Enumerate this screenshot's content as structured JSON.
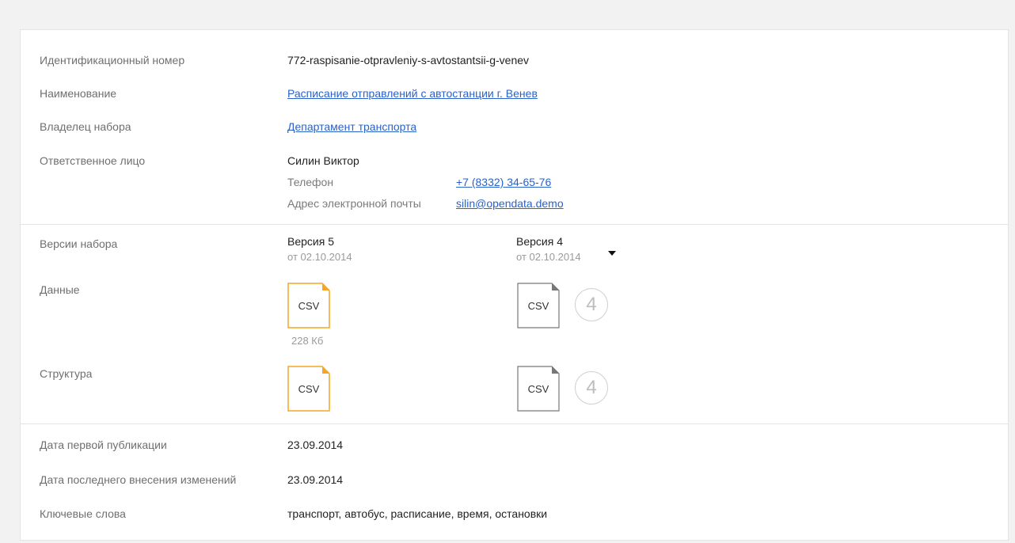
{
  "fields": {
    "id": {
      "label": "Идентификационный номер",
      "value": "772-raspisanie-otpravleniy-s-avtostantsii-g-venev"
    },
    "name": {
      "label": "Наименование",
      "value": "Расписание отправлений с автостанции г. Венев"
    },
    "owner": {
      "label": "Владелец набора",
      "value": "Департамент транспорта"
    },
    "responsible": {
      "label": "Ответственное лицо",
      "person": "Силин Виктор",
      "phone_label": "Телефон",
      "phone": "+7 (8332) 34-65-76",
      "email_label": "Адрес электронной почты",
      "email": "silin@opendata.demo"
    }
  },
  "versions": {
    "label": "Версии набора",
    "current": {
      "title": "Версия 5",
      "date": "от 02.10.2014"
    },
    "previous": {
      "title": "Версия 4",
      "date": "от 02.10.2014"
    },
    "data_label": "Данные",
    "structure_label": "Структура",
    "current_data_file": {
      "format": "CSV",
      "size": "228 Кб"
    },
    "previous_data_file": {
      "format": "CSV",
      "count": "4"
    },
    "current_structure_file": {
      "format": "CSV"
    },
    "previous_structure_file": {
      "format": "CSV",
      "count": "4"
    },
    "accent_color": "#f5a623"
  },
  "dates": {
    "first_pub_label": "Дата первой публикации",
    "first_pub": "23.09.2014",
    "last_change_label": "Дата последнего внесения изменений",
    "last_change": "23.09.2014",
    "keywords_label": "Ключевые слова",
    "keywords": "транспорт, автобус, расписание, время, остановки"
  }
}
